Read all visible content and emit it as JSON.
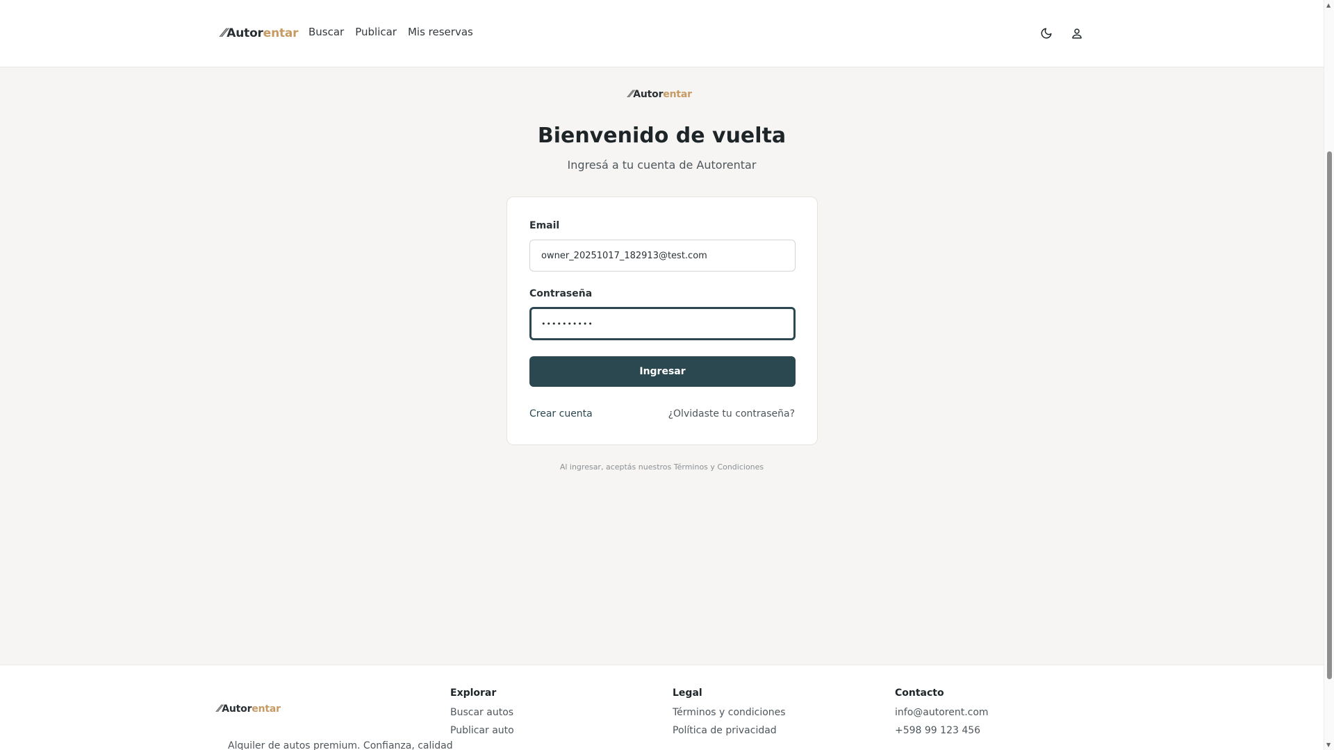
{
  "brand": {
    "mark": "⁄⁄",
    "part1": "Autor",
    "part2": "entar",
    "accent_color": "#c79a63",
    "primary_color": "#2b4850"
  },
  "nav": {
    "items": [
      "Buscar",
      "Publicar",
      "Mis reservas"
    ]
  },
  "header_icons": {
    "theme": "moon-icon",
    "account": "user-icon"
  },
  "login": {
    "title": "Bienvenido de vuelta",
    "subtitle": "Ingresá a tu cuenta de Autorentar",
    "email_label": "Email",
    "email_value": "owner_20251017_182913@test.com",
    "password_label": "Contraseña",
    "password_value": "••••••••••",
    "submit_label": "Ingresar",
    "create_account": "Crear cuenta",
    "forgot_password": "¿Olvidaste tu contraseña?",
    "terms": "Al ingresar, aceptás nuestros Términos y Condiciones"
  },
  "footer": {
    "description": "Alquiler de autos premium. Confianza, calidad",
    "columns": [
      {
        "heading": "Explorar",
        "links": [
          "Buscar autos",
          "Publicar auto"
        ]
      },
      {
        "heading": "Legal",
        "links": [
          "Términos y condiciones",
          "Política de privacidad"
        ]
      },
      {
        "heading": "Contacto",
        "links": [
          "info@autorent.com",
          "+598 99 123 456"
        ]
      }
    ]
  }
}
